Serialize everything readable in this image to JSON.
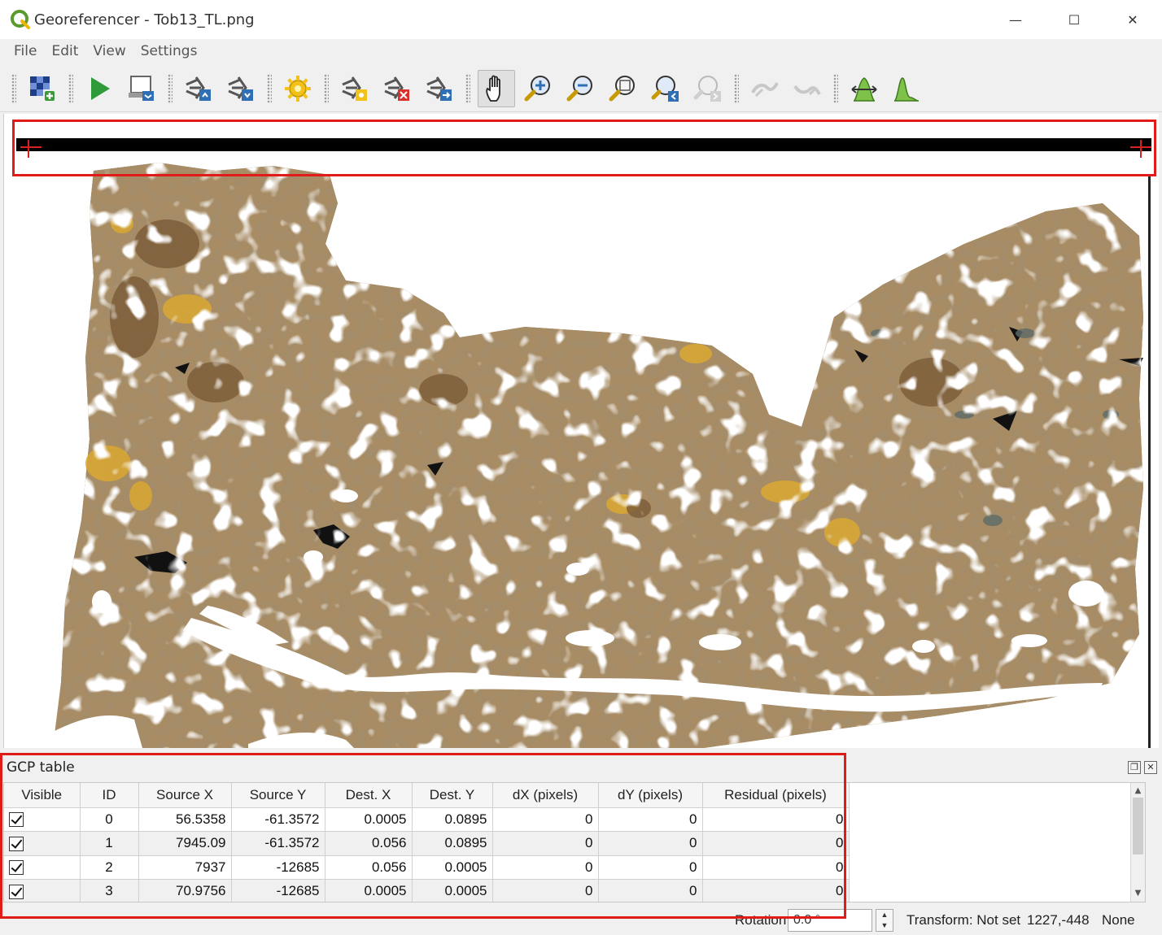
{
  "window": {
    "title": "Georeferencer - Tob13_TL.png",
    "controls": [
      "—",
      "☐",
      "✕"
    ]
  },
  "menu": [
    "File",
    "Edit",
    "View",
    "Settings"
  ],
  "toolbar": {
    "icons": [
      "open-raster-icon",
      "start-georeferencing-icon",
      "generate-gdal-script-icon",
      "load-gcp-points-icon",
      "save-gcp-points-icon",
      "transformation-settings-icon",
      "add-point-icon",
      "delete-point-icon",
      "move-gcp-point-icon",
      "pan-icon",
      "zoom-in-icon",
      "zoom-out-icon",
      "zoom-to-layer-icon",
      "zoom-last-icon",
      "zoom-next-icon",
      "link-georeferencer-to-qgis-icon",
      "link-qgis-to-georeferencer-icon",
      "full-histogram-stretch-icon",
      "local-histogram-stretch-icon"
    ]
  },
  "gcp_panel": {
    "title": "GCP table",
    "columns": [
      "Visible",
      "ID",
      "Source X",
      "Source Y",
      "Dest. X",
      "Dest. Y",
      "dX (pixels)",
      "dY (pixels)",
      "Residual (pixels)"
    ],
    "rows": [
      {
        "visible": true,
        "id": "0",
        "source_x": "56.5358",
        "source_y": "-61.3572",
        "dest_x": "0.0005",
        "dest_y": "0.0895",
        "dx": "0",
        "dy": "0",
        "residual": "0"
      },
      {
        "visible": true,
        "id": "1",
        "source_x": "7945.09",
        "source_y": "-61.3572",
        "dest_x": "0.056",
        "dest_y": "0.0895",
        "dx": "0",
        "dy": "0",
        "residual": "0"
      },
      {
        "visible": true,
        "id": "2",
        "source_x": "7937",
        "source_y": "-12685",
        "dest_x": "0.056",
        "dest_y": "0.0005",
        "dx": "0",
        "dy": "0",
        "residual": "0"
      },
      {
        "visible": true,
        "id": "3",
        "source_x": "70.9756",
        "source_y": "-12685",
        "dest_x": "0.0005",
        "dest_y": "0.0005",
        "dx": "0",
        "dy": "0",
        "residual": "0"
      }
    ]
  },
  "statusbar": {
    "rotation_label": "Rotation",
    "rotation_value": "0.0 °",
    "transform": "Transform: Not set",
    "coordinates": "1227,-448",
    "crs": "None"
  },
  "colors": {
    "highlight": "#e11a1a",
    "qgis_green": "#5b9a2e"
  }
}
